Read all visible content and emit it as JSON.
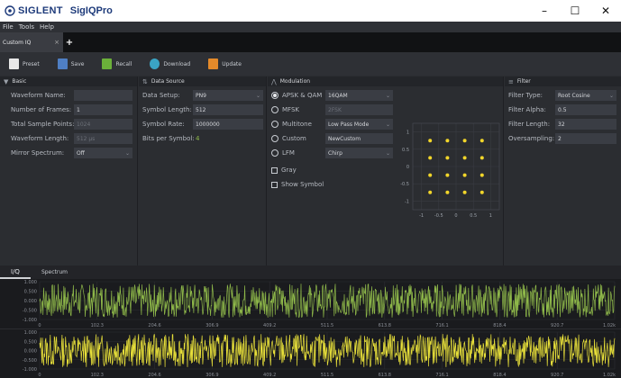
{
  "titlebar": {
    "brand": "SIGLENT",
    "app": "SigIQPro",
    "minimize": "–",
    "maximize": "☐",
    "close": "✕"
  },
  "menu": [
    "File",
    "Tools",
    "Help"
  ],
  "doc_tab": {
    "label": "Custom IQ",
    "close": "×",
    "add": "+"
  },
  "toolbar": [
    {
      "label": "Preset",
      "color": "#e8e8e8"
    },
    {
      "label": "Save",
      "color": "#4f7fc4"
    },
    {
      "label": "Recall",
      "color": "#6bb03a"
    },
    {
      "label": "Download",
      "color": "#3aa4c4"
    },
    {
      "label": "Update",
      "color": "#e48a2a"
    }
  ],
  "basic": {
    "title": "Basic",
    "icon": "▼",
    "rows": [
      {
        "label": "Waveform Name:",
        "value": ""
      },
      {
        "label": "Number of Frames:",
        "value": "1"
      },
      {
        "label": "Total Sample Points:",
        "value": "1024"
      },
      {
        "label": "Waveform Length:",
        "value": "512 μs"
      },
      {
        "label": "Mirror Spectrum:",
        "value": "Off"
      }
    ]
  },
  "data_source": {
    "title": "Data Source",
    "icon": "⇅",
    "rows": [
      {
        "label": "Data Setup:",
        "value": "PN9"
      },
      {
        "label": "Symbol Length:",
        "value": "512"
      },
      {
        "label": "Symbol Rate:",
        "value": "1000000"
      },
      {
        "label": "Bits per Symbol:",
        "value": "4"
      }
    ]
  },
  "modulation": {
    "title": "Modulation",
    "icon": "⋀",
    "options": [
      {
        "label": "APSK & QAM",
        "value": "16QAM",
        "selected": true
      },
      {
        "label": "MFSK",
        "value": "2FSK",
        "selected": false
      },
      {
        "label": "Multitone",
        "value": "Low Pass Mode",
        "selected": false
      },
      {
        "label": "Custom",
        "value": "NewCustom",
        "selected": false
      },
      {
        "label": "LFM",
        "value": "Chirp",
        "selected": false
      }
    ],
    "checks": [
      "Gray",
      "Show Symbol"
    ],
    "constellation": {
      "yticks": [
        "1",
        "0.5",
        "0",
        "-0.5",
        "-1"
      ],
      "xticks": [
        "-1",
        "-0.5",
        "0",
        "0.5",
        "1"
      ],
      "points": [
        [
          -0.75,
          0.75
        ],
        [
          -0.25,
          0.75
        ],
        [
          0.25,
          0.75
        ],
        [
          0.75,
          0.75
        ],
        [
          -0.75,
          0.25
        ],
        [
          -0.25,
          0.25
        ],
        [
          0.25,
          0.25
        ],
        [
          0.75,
          0.25
        ],
        [
          -0.75,
          -0.25
        ],
        [
          -0.25,
          -0.25
        ],
        [
          0.25,
          -0.25
        ],
        [
          0.75,
          -0.25
        ],
        [
          -0.75,
          -0.75
        ],
        [
          -0.25,
          -0.75
        ],
        [
          0.25,
          -0.75
        ],
        [
          0.75,
          -0.75
        ]
      ]
    }
  },
  "filter": {
    "title": "Filter",
    "icon": "≡",
    "rows": [
      {
        "label": "Filter Type:",
        "value": "Root Cosine"
      },
      {
        "label": "Filter Alpha:",
        "value": "0.5"
      },
      {
        "label": "Filter Length:",
        "value": "32"
      },
      {
        "label": "Oversampling:",
        "value": "2"
      }
    ]
  },
  "bottom_tabs": [
    "I/Q",
    "Spectrum"
  ],
  "plots": {
    "xticks": [
      "0",
      "102.3",
      "204.6",
      "306.9",
      "409.2",
      "511.5",
      "613.8",
      "716.1",
      "818.4",
      "920.7",
      "1.02k"
    ],
    "plot1": {
      "yticks": [
        "1.000",
        "0.500",
        "0.000",
        "-0.500",
        "-1.000"
      ],
      "color": "#8fb94a"
    },
    "plot2": {
      "yticks": [
        "1.000",
        "0.500",
        "0.000",
        "-0.500",
        "-1.000"
      ],
      "color": "#e8e03a"
    }
  }
}
